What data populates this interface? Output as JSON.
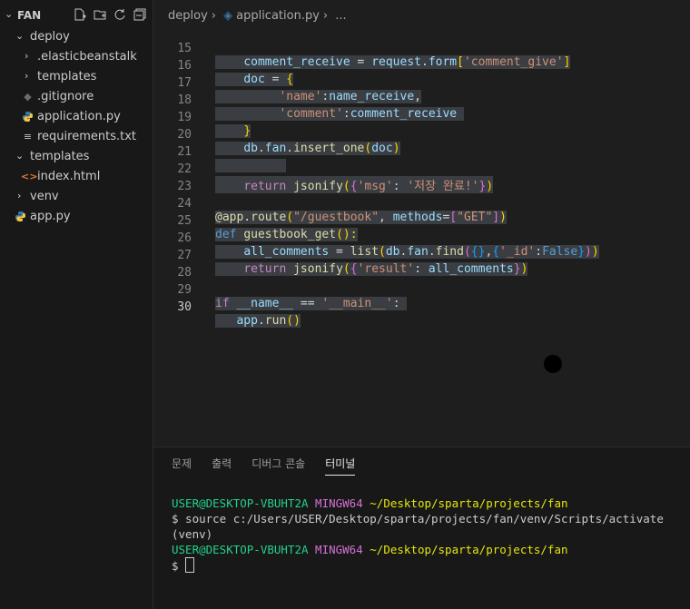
{
  "explorer": {
    "title": "FAN",
    "items": [
      {
        "label": "deploy",
        "kind": "folder-open"
      },
      {
        "label": ".elasticbeanstalk",
        "kind": "folder"
      },
      {
        "label": "templates",
        "kind": "folder"
      },
      {
        "label": ".gitignore",
        "kind": "gitignore"
      },
      {
        "label": "application.py",
        "kind": "python"
      },
      {
        "label": "requirements.txt",
        "kind": "text"
      },
      {
        "label": "templates",
        "kind": "folder-open"
      },
      {
        "label": "index.html",
        "kind": "html"
      },
      {
        "label": "venv",
        "kind": "folder"
      },
      {
        "label": "app.py",
        "kind": "python"
      }
    ]
  },
  "breadcrumb": {
    "folder": "deploy",
    "file": "application.py",
    "more": "..."
  },
  "code": {
    "line_numbers": [
      "15",
      "16",
      "17",
      "18",
      "19",
      "20",
      "21",
      "22",
      "23",
      "24",
      "25",
      "26",
      "27",
      "28",
      "29",
      "30"
    ],
    "l15": [
      "comment_receive",
      " = ",
      "request",
      ".",
      "form",
      "[",
      "'comment_give'",
      "]"
    ],
    "l16": [
      "doc",
      " = ",
      "{"
    ],
    "l17": [
      "'name'",
      ":",
      "name_receive",
      ","
    ],
    "l18": [
      "'comment'",
      ":",
      "comment_receive"
    ],
    "l19": [
      "}"
    ],
    "l20": [
      "db",
      ".",
      "fan",
      ".",
      "insert_one",
      "(",
      "doc",
      ")"
    ],
    "l22": [
      "return",
      " ",
      "jsonify",
      "(",
      "{",
      "'msg'",
      ": ",
      "'저장 완료!'",
      "}",
      ")"
    ],
    "l24": [
      "@app.route",
      "(",
      "\"/guestbook\"",
      ", ",
      "methods",
      "=",
      "[",
      "\"GET\"",
      "]",
      ")"
    ],
    "l25": [
      "def",
      " ",
      "guestbook_get",
      "():"
    ],
    "l26": [
      "all_comments",
      " = ",
      "list",
      "(",
      "db",
      ".",
      "fan",
      ".",
      "find",
      "(",
      "{}",
      ",",
      "{",
      "'_id'",
      ":",
      "False",
      "}",
      ")",
      ")"
    ],
    "l27": [
      "return",
      " ",
      "jsonify",
      "(",
      "{",
      "'result'",
      ": ",
      "all_comments",
      "}",
      ")"
    ],
    "l29": [
      "if",
      " ",
      "__name__",
      " == ",
      "'__main__'",
      ":"
    ],
    "l30": [
      "app",
      ".",
      "run",
      "()"
    ]
  },
  "panel": {
    "tabs": [
      "문제",
      "출력",
      "디버그 콘솔",
      "터미널"
    ],
    "active_tab": "터미널",
    "terminal": {
      "user1": "USER@DESKTOP-VBUHT2A",
      "ming1": "MINGW64",
      "path1": "~/Desktop/sparta/projects/fan",
      "cmd": "$ source c:/Users/USER/Desktop/sparta/projects/fan/venv/Scripts/activate",
      "venv": "(venv)",
      "user2": "USER@DESKTOP-VBUHT2A",
      "ming2": "MINGW64",
      "path2": "~/Desktop/sparta/projects/fan",
      "prompt": "$ "
    }
  },
  "colors": {
    "background": "#1e1e1e",
    "sidebar": "#181818",
    "selection": "#3a3d41"
  }
}
